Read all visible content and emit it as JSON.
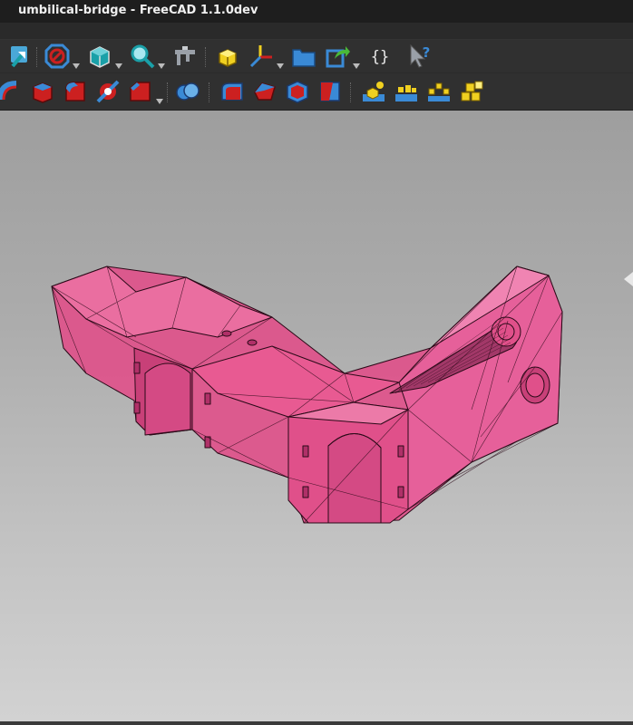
{
  "window": {
    "title": "umbilical-bridge - FreeCAD 1.1.0dev"
  },
  "toolbar1": [
    {
      "name": "std-workbench-icon"
    },
    {
      "name": "draw-style-icon",
      "dropdown": true
    },
    {
      "name": "view-box-icon",
      "dropdown": true
    },
    {
      "name": "zoom-icon",
      "dropdown": true
    },
    {
      "name": "measure-caliper-icon"
    },
    {
      "name": "part-icon"
    },
    {
      "name": "axis-icon",
      "dropdown": true
    },
    {
      "name": "group-folder-icon"
    },
    {
      "name": "link-icon",
      "dropdown": true
    },
    {
      "name": "macro-braces-icon"
    },
    {
      "name": "whats-this-icon"
    }
  ],
  "toolbar2": [
    {
      "name": "revolve-icon"
    },
    {
      "name": "mirror-icon"
    },
    {
      "name": "fillet-icon"
    },
    {
      "name": "section-icon"
    },
    {
      "name": "chamfer-icon",
      "dropdown": true
    },
    {
      "name": "boolean-icon"
    },
    {
      "name": "cut-icon"
    },
    {
      "name": "fuse-icon"
    },
    {
      "name": "common-icon"
    },
    {
      "name": "thickness-icon"
    },
    {
      "name": "compound-icon"
    },
    {
      "name": "shape-builder-icon"
    },
    {
      "name": "explode-compound-icon"
    },
    {
      "name": "compound-filter-icon"
    }
  ],
  "colors": {
    "model_fill": "#e0508a",
    "model_edge": "#2a0a18",
    "icon_blue": "#3a8ad6",
    "icon_red": "#cc2020",
    "icon_yellow": "#f0d020",
    "icon_teal": "#1aa0a8"
  }
}
